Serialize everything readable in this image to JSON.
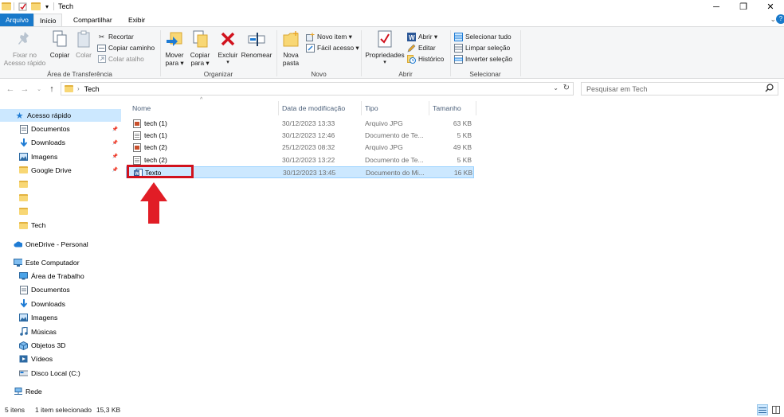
{
  "window": {
    "title": "Tech",
    "controls": {
      "minimize": "─",
      "maximize": "❐",
      "close": "✕"
    }
  },
  "tabs": [
    {
      "label": "Arquivo"
    },
    {
      "label": "Início"
    },
    {
      "label": "Compartilhar"
    },
    {
      "label": "Exibir"
    }
  ],
  "ribbon": {
    "clipboard": {
      "label": "Área de Transferência",
      "pin": "Fixar no Acesso rápido",
      "copy": "Copiar",
      "paste": "Colar",
      "cut": "Recortar",
      "copy_path": "Copiar caminho",
      "paste_shortcut": "Colar atalho"
    },
    "organize": {
      "label": "Organizar",
      "move_to": "Mover para",
      "copy_to": "Copiar para",
      "delete": "Excluir",
      "rename": "Renomear"
    },
    "new": {
      "label": "Novo",
      "new_folder": "Nova pasta",
      "new_item": "Novo item",
      "easy_access": "Fácil acesso"
    },
    "open": {
      "label": "Abrir",
      "properties": "Propriedades",
      "open": "Abrir",
      "edit": "Editar",
      "history": "Histórico"
    },
    "select": {
      "label": "Selecionar",
      "select_all": "Selecionar tudo",
      "select_none": "Limpar seleção",
      "invert": "Inverter seleção"
    }
  },
  "address": {
    "path": "Tech",
    "search_placeholder": "Pesquisar em Tech"
  },
  "nav": {
    "quick_access": "Acesso rápido",
    "quick_items": [
      "Documentos",
      "Downloads",
      "Imagens",
      "Google Drive",
      "",
      "",
      "",
      "Tech"
    ],
    "onedrive": "OneDrive - Personal",
    "this_pc": "Este Computador",
    "pc_items": [
      "Área de Trabalho",
      "Documentos",
      "Downloads",
      "Imagens",
      "Músicas",
      "Objetos 3D",
      "Vídeos",
      "Disco Local (C:)"
    ],
    "network": "Rede"
  },
  "columns": {
    "name": "Nome",
    "date": "Data de modificação",
    "type": "Tipo",
    "size": "Tamanho"
  },
  "files": [
    {
      "name": "tech (1)",
      "date": "30/12/2023 13:33",
      "type": "Arquivo JPG",
      "size": "63 KB",
      "icon": "jpg-file-icon"
    },
    {
      "name": "tech (1)",
      "date": "30/12/2023 12:46",
      "type": "Documento de Te...",
      "size": "5 KB",
      "icon": "text-file-icon"
    },
    {
      "name": "tech (2)",
      "date": "25/12/2023 08:32",
      "type": "Arquivo JPG",
      "size": "49 KB",
      "icon": "jpg-file-icon"
    },
    {
      "name": "tech (2)",
      "date": "30/12/2023 13:22",
      "type": "Documento de Te...",
      "size": "5 KB",
      "icon": "text-file-icon"
    },
    {
      "name": "Texto",
      "date": "30/12/2023 13:45",
      "type": "Documento do Mi...",
      "size": "16 KB",
      "icon": "word-file-icon"
    }
  ],
  "status": {
    "count": "5 itens",
    "selected": "1 item selecionado",
    "size": "15,3 KB"
  },
  "colors": {
    "file_tab": "#1979ca",
    "selection": "#cce8ff",
    "annotation_red": "#d1121d"
  }
}
